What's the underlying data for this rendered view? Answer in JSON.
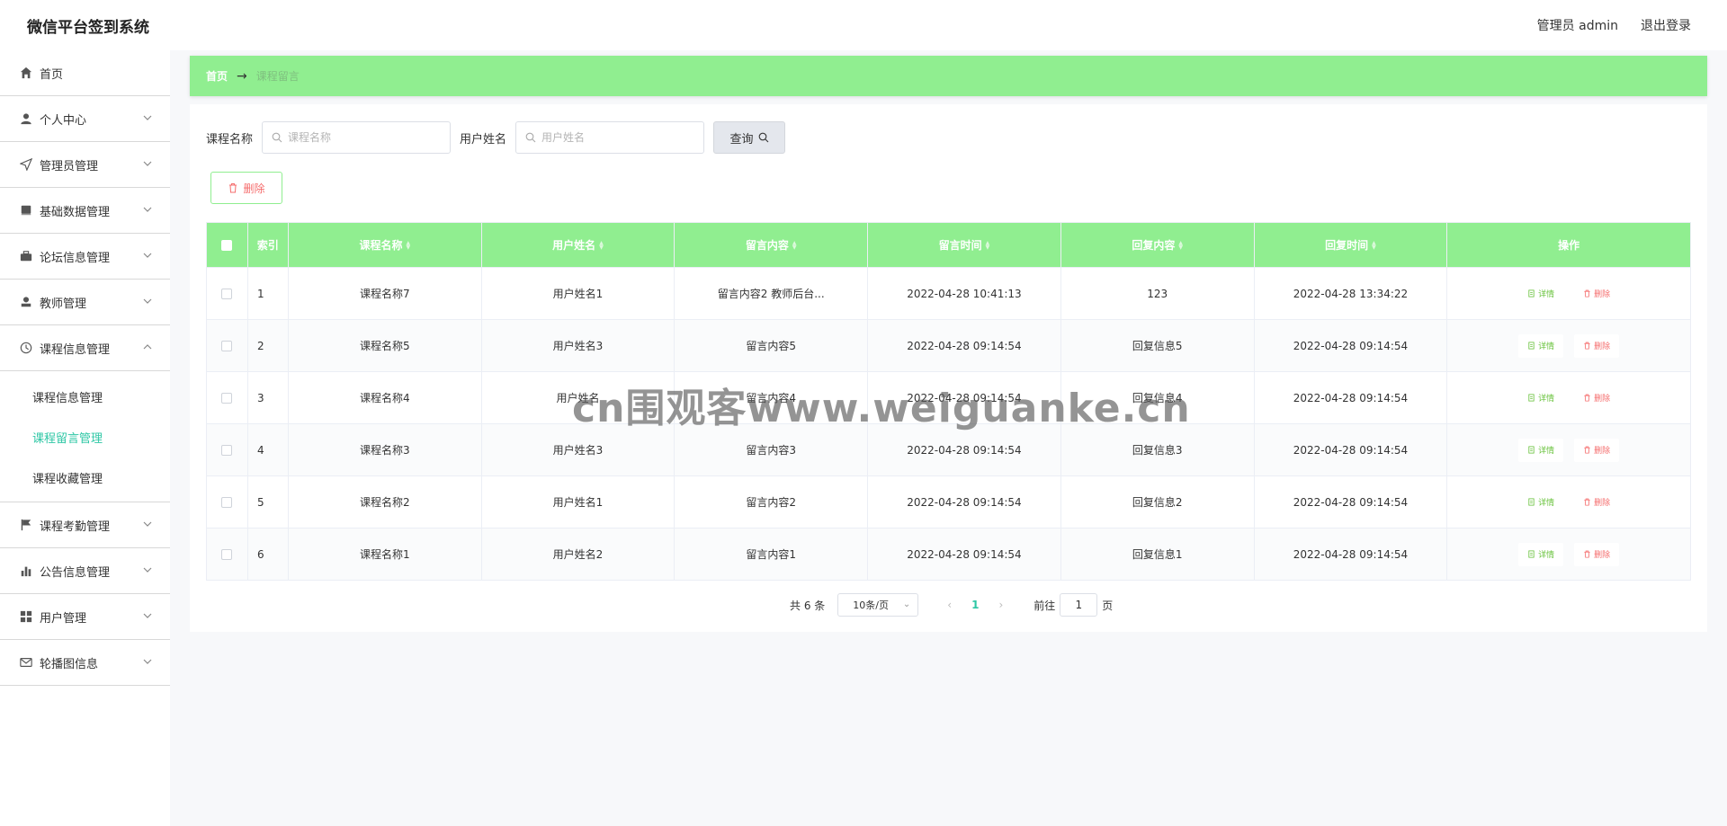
{
  "header": {
    "title": "微信平台签到系统",
    "admin_label": "管理员 admin",
    "logout_label": "退出登录"
  },
  "sidebar": {
    "items": [
      {
        "label": "首页",
        "icon": "home-icon"
      },
      {
        "label": "个人中心",
        "icon": "user-icon"
      },
      {
        "label": "管理员管理",
        "icon": "send-icon"
      },
      {
        "label": "基础数据管理",
        "icon": "book-icon"
      },
      {
        "label": "论坛信息管理",
        "icon": "briefcase-icon"
      },
      {
        "label": "教师管理",
        "icon": "stamp-icon"
      },
      {
        "label": "课程信息管理",
        "icon": "clock-icon"
      },
      {
        "label": "课程考勤管理",
        "icon": "flag-icon"
      },
      {
        "label": "公告信息管理",
        "icon": "bar-chart-icon"
      },
      {
        "label": "用户管理",
        "icon": "grid-icon"
      },
      {
        "label": "轮播图信息",
        "icon": "mail-icon"
      }
    ],
    "submenu": [
      {
        "label": "课程信息管理"
      },
      {
        "label": "课程留言管理"
      },
      {
        "label": "课程收藏管理"
      }
    ]
  },
  "breadcrumb": {
    "home": "首页",
    "arrow": "→",
    "current": "课程留言"
  },
  "search": {
    "course_label": "课程名称",
    "course_placeholder": "课程名称",
    "user_label": "用户姓名",
    "user_placeholder": "用户姓名",
    "query_label": "查询"
  },
  "toolbar": {
    "delete_label": "删除"
  },
  "table": {
    "headers": [
      "索引",
      "课程名称",
      "用户姓名",
      "留言内容",
      "留言时间",
      "回复内容",
      "回复时间",
      "操作"
    ],
    "rows": [
      [
        "1",
        "课程名称7",
        "用户姓名1",
        "留言内容2 教师后台...",
        "2022-04-28 10:41:13",
        "123",
        "2022-04-28 13:34:22"
      ],
      [
        "2",
        "课程名称5",
        "用户姓名3",
        "留言内容5",
        "2022-04-28 09:14:54",
        "回复信息5",
        "2022-04-28 09:14:54"
      ],
      [
        "3",
        "课程名称4",
        "用户姓名",
        "留言内容4",
        "2022-04-28 09:14:54",
        "回复信息4",
        "2022-04-28 09:14:54"
      ],
      [
        "4",
        "课程名称3",
        "用户姓名3",
        "留言内容3",
        "2022-04-28 09:14:54",
        "回复信息3",
        "2022-04-28 09:14:54"
      ],
      [
        "5",
        "课程名称2",
        "用户姓名1",
        "留言内容2",
        "2022-04-28 09:14:54",
        "回复信息2",
        "2022-04-28 09:14:54"
      ],
      [
        "6",
        "课程名称1",
        "用户姓名2",
        "留言内容1",
        "2022-04-28 09:14:54",
        "回复信息1",
        "2022-04-28 09:14:54"
      ]
    ],
    "detail_label": "详情",
    "remove_label": "删除"
  },
  "pagination": {
    "total": "共 6 条",
    "page_size": "10条/页",
    "prev": "‹",
    "current_page": "1",
    "next": "›",
    "goto_label": "前往",
    "goto_value": "1",
    "page_suffix": "页"
  },
  "watermark": "cn围观客www.weiguanke.cn",
  "colors": {
    "accent_green": "#90ee90",
    "active_teal": "#2ec7a5",
    "danger": "#f56c6c",
    "success": "#67c23a"
  }
}
